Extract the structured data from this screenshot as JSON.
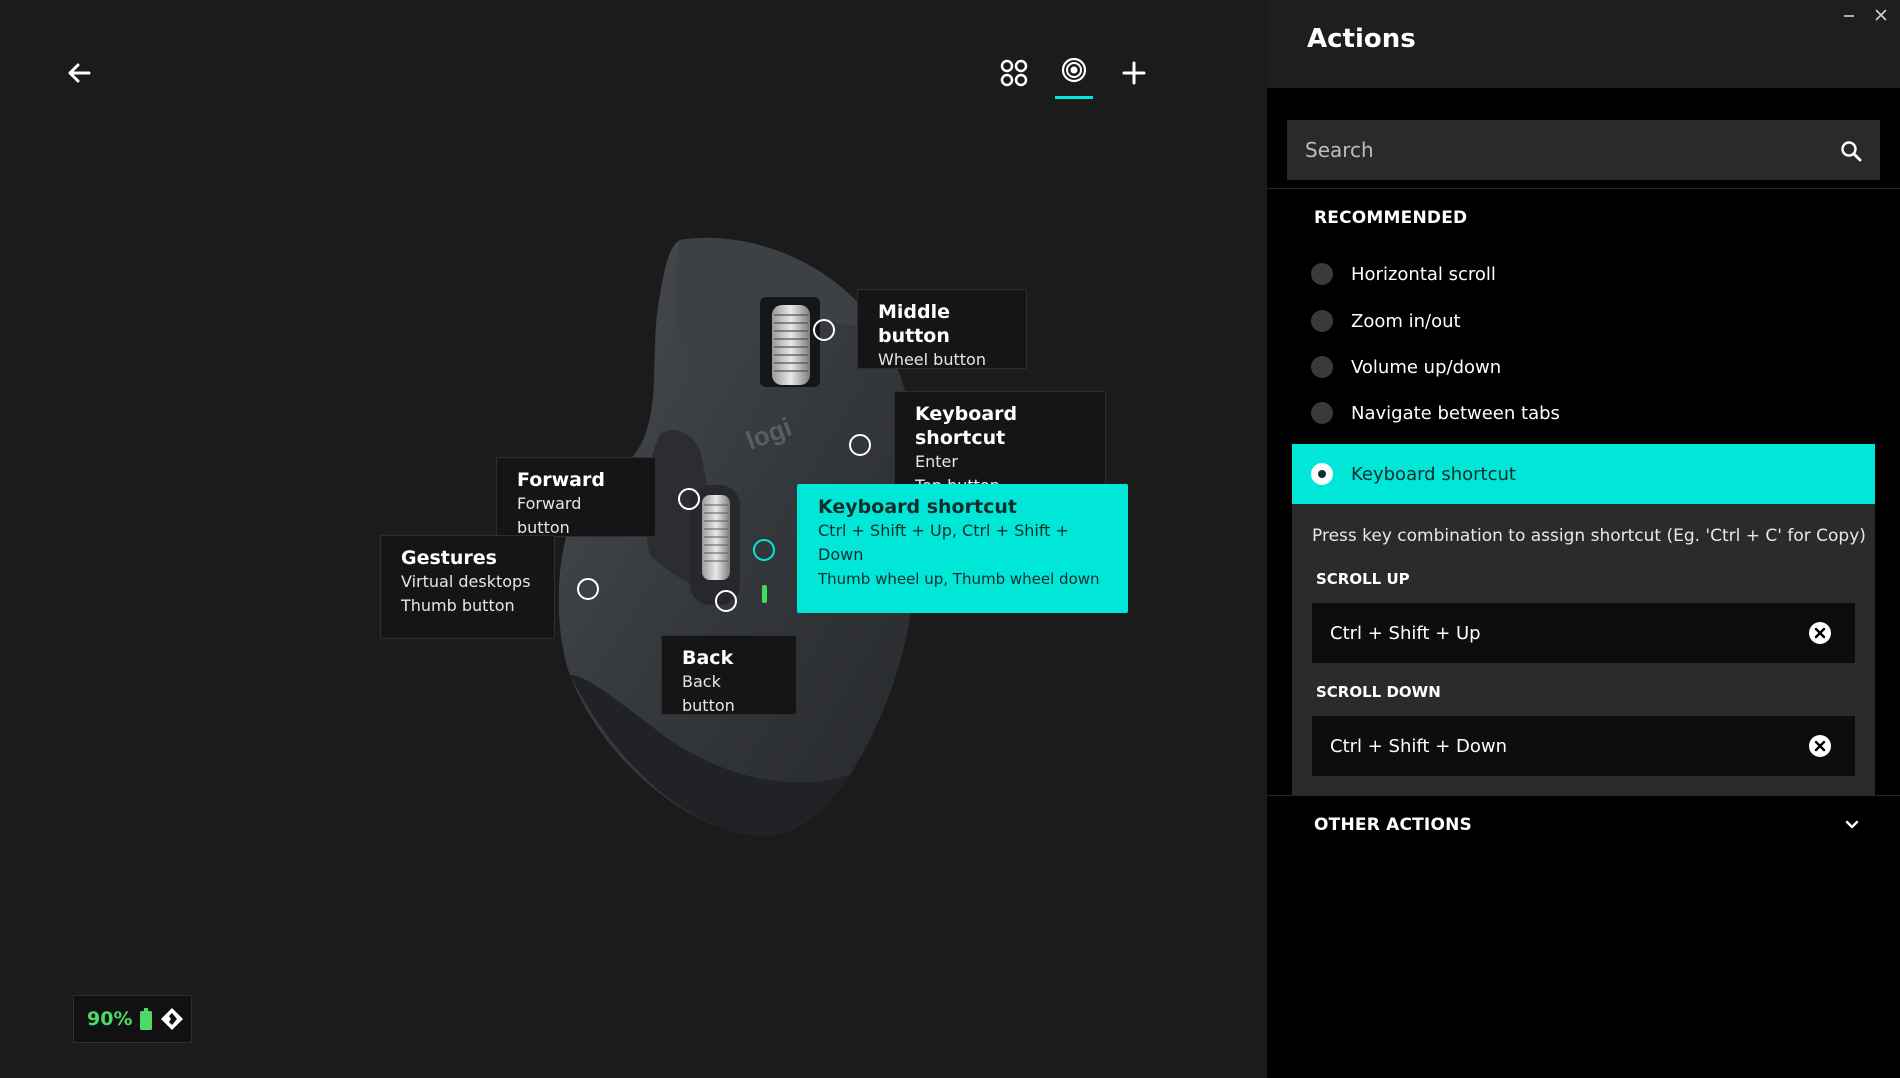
{
  "nav": {
    "back_icon": "arrow-left-icon",
    "tabs": [
      {
        "icon": "apps-grid-icon",
        "active": false
      },
      {
        "icon": "mouse-buttons-icon",
        "active": true
      },
      {
        "icon": "plus-icon",
        "active": false
      }
    ]
  },
  "device": {
    "brand_mark": "logi",
    "labels": {
      "middle": {
        "title": "Middle button",
        "sub": "Wheel button"
      },
      "top": {
        "title": "Keyboard shortcut",
        "line1": "Enter",
        "line2": "Top button"
      },
      "forward": {
        "title": "Forward",
        "sub": "Forward button"
      },
      "thumbwheel": {
        "title": "Keyboard shortcut",
        "line1": "Ctrl + Shift + Up, Ctrl + Shift + Down",
        "line2": "Thumb wheel up, Thumb wheel down"
      },
      "gestures": {
        "title": "Gestures",
        "line1": "Virtual desktops",
        "line2": "Thumb button"
      },
      "back": {
        "title": "Back",
        "sub": "Back button"
      }
    }
  },
  "battery": {
    "percent": "90%",
    "color": "#4cd964"
  },
  "panel": {
    "title": "Actions",
    "search": {
      "placeholder": "Search",
      "value": ""
    },
    "recommended_label": "RECOMMENDED",
    "recommended": [
      {
        "label": "Horizontal scroll"
      },
      {
        "label": "Zoom in/out"
      },
      {
        "label": "Volume up/down"
      },
      {
        "label": "Navigate between tabs"
      }
    ],
    "selected": {
      "label": "Keyboard shortcut",
      "hint": "Press key combination to assign shortcut (Eg. 'Ctrl + C' for Copy)",
      "scroll_up_label": "SCROLL UP",
      "scroll_up_value": "Ctrl + Shift + Up",
      "scroll_down_label": "SCROLL DOWN",
      "scroll_down_value": "Ctrl + Shift + Down"
    },
    "other_actions_label": "OTHER ACTIONS"
  },
  "accent_color": "#00e6d7"
}
